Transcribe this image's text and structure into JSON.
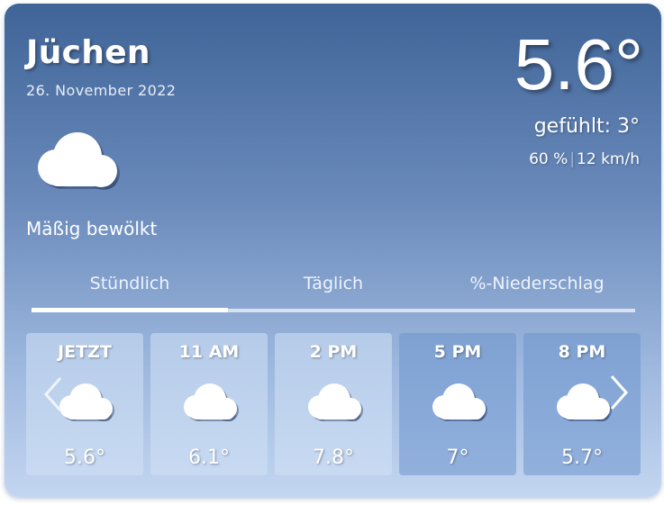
{
  "location": {
    "city": "Jüchen",
    "date": "26. November 2022"
  },
  "current": {
    "temperature": "5.6°",
    "feels_like": "gefühlt: 3°",
    "humidity": "60 %",
    "wind": "12 km/h",
    "condition": "Mäßig bewölkt",
    "icon": "cloud-icon"
  },
  "tabs": [
    {
      "label": "Stündlich",
      "active": true
    },
    {
      "label": "Täglich",
      "active": false
    },
    {
      "label": "%-Niederschlag",
      "active": false
    }
  ],
  "hourly": [
    {
      "label": "JETZT",
      "temp": "5.6°",
      "icon": "cloud-icon"
    },
    {
      "label": "11 AM",
      "temp": "6.1°",
      "icon": "cloud-icon"
    },
    {
      "label": "2 PM",
      "temp": "7.8°",
      "icon": "cloud-icon"
    },
    {
      "label": "5 PM",
      "temp": "7°",
      "icon": "cloud-icon"
    },
    {
      "label": "8 PM",
      "temp": "5.7°",
      "icon": "cloud-icon"
    }
  ],
  "colors": {
    "card_top": "#3f6497",
    "card_bottom": "#c3d6f1",
    "text": "#ffffff"
  }
}
